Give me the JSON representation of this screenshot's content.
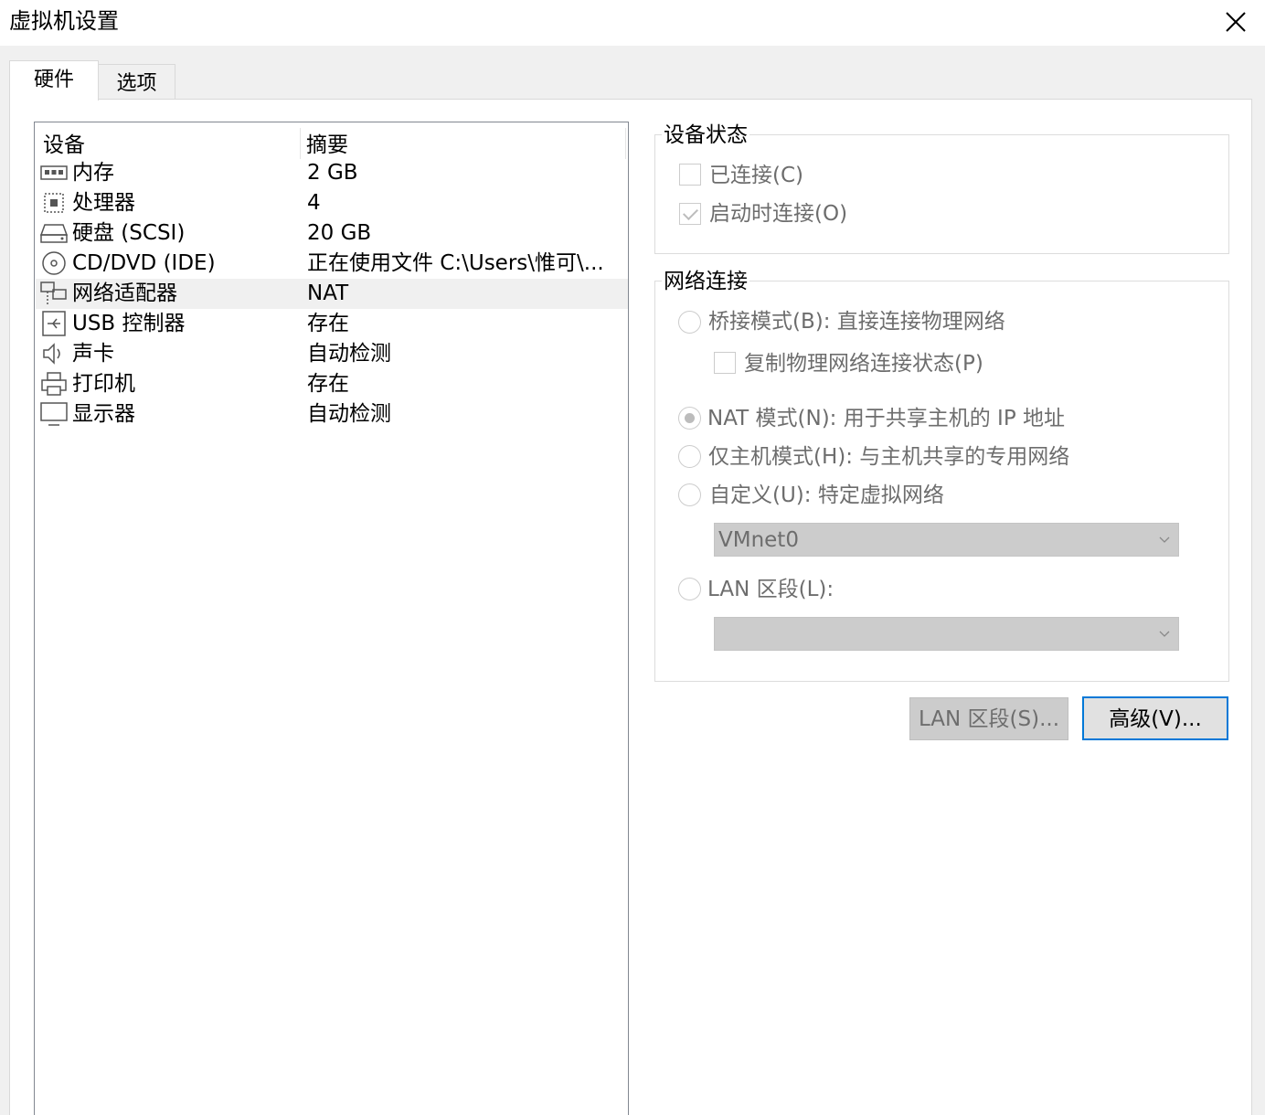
{
  "window": {
    "title": "虚拟机设置"
  },
  "tabs": [
    {
      "label": "硬件"
    },
    {
      "label": "选项"
    }
  ],
  "device_list": {
    "headers": {
      "device": "设备",
      "summary": "摘要"
    },
    "rows": [
      {
        "name": "内存",
        "summary": "2 GB",
        "icon": "memory-icon"
      },
      {
        "name": "处理器",
        "summary": "4",
        "icon": "processor-icon"
      },
      {
        "name": "硬盘 (SCSI)",
        "summary": "20 GB",
        "icon": "hard-disk-icon"
      },
      {
        "name": "CD/DVD (IDE)",
        "summary": "正在使用文件 C:\\Users\\惟可\\...",
        "icon": "cd-dvd-icon"
      },
      {
        "name": "网络适配器",
        "summary": "NAT",
        "icon": "network-adapter-icon",
        "selected": true
      },
      {
        "name": "USB 控制器",
        "summary": "存在",
        "icon": "usb-icon"
      },
      {
        "name": "声卡",
        "summary": "自动检测",
        "icon": "speaker-icon"
      },
      {
        "name": "打印机",
        "summary": "存在",
        "icon": "printer-icon"
      },
      {
        "name": "显示器",
        "summary": "自动检测",
        "icon": "monitor-icon"
      }
    ]
  },
  "device_status": {
    "title": "设备状态",
    "connected": {
      "label": "已连接(C)",
      "checked": false
    },
    "connect_at_power_on": {
      "label": "启动时连接(O)",
      "checked": true
    }
  },
  "network_connection": {
    "title": "网络连接",
    "bridged": {
      "label": "桥接模式(B): 直接连接物理网络",
      "checked": false
    },
    "replicate": {
      "label": "复制物理网络连接状态(P)",
      "checked": false
    },
    "nat": {
      "label": "NAT 模式(N): 用于共享主机的 IP 地址",
      "checked": true
    },
    "host_only": {
      "label": "仅主机模式(H): 与主机共享的专用网络",
      "checked": false
    },
    "custom": {
      "label": "自定义(U): 特定虚拟网络",
      "checked": false
    },
    "custom_select": {
      "value": "VMnet0"
    },
    "lan_segment": {
      "label": "LAN 区段(L):",
      "checked": false
    },
    "lan_select": {
      "value": ""
    }
  },
  "buttons": {
    "lan_segments": "LAN 区段(S)...",
    "advanced": "高级(V)..."
  },
  "colors": {
    "accent": "#0078d7",
    "disabled_text": "#6d6d6d",
    "selected_row": "#f0f0f0"
  }
}
